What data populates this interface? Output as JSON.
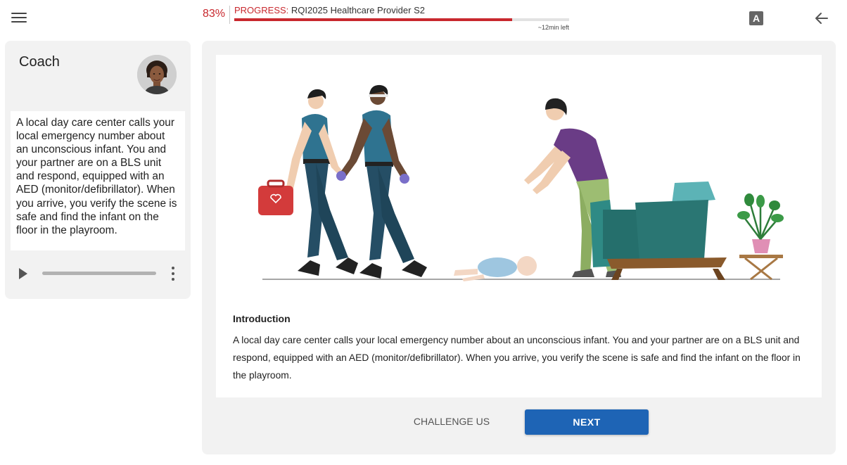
{
  "header": {
    "menu_icon": "hamburger-menu-icon",
    "progress_percent_text": "83%",
    "progress_label": "PROGRESS:",
    "course_name": "RQI2025 Healthcare Provider S2",
    "progress_fraction": 0.83,
    "time_left": "~12min left",
    "font_toggle_glyph": "A",
    "font_toggle_icon": "text-size-icon",
    "back_icon": "arrow-left-icon",
    "accent_color": "#c8282e"
  },
  "coach": {
    "title": "Coach",
    "avatar_icon": "coach-avatar",
    "message": "A local day care center calls your local emergency number about an unconscious infant. You and your partner are on a BLS unit and respond, equipped with an AED (monitor/defibrillator). When you arrive, you verify the scene is safe and find the infant on the floor in the playroom.",
    "audio": {
      "play_icon": "play-icon",
      "more_icon": "more-vertical-icon"
    }
  },
  "content": {
    "illustration": "paramedics-infant-scene",
    "intro_heading": "Introduction",
    "intro_text": "A local day care center calls your local emergency number about an unconscious infant. You and your partner are on a BLS unit and respond, equipped with an AED (monitor/defibrillator). When you arrive, you verify the scene is safe and find the infant on the floor in the playroom.",
    "challenge_label": "CHALLENGE US",
    "next_label": "NEXT",
    "primary_color": "#1e64b5"
  }
}
